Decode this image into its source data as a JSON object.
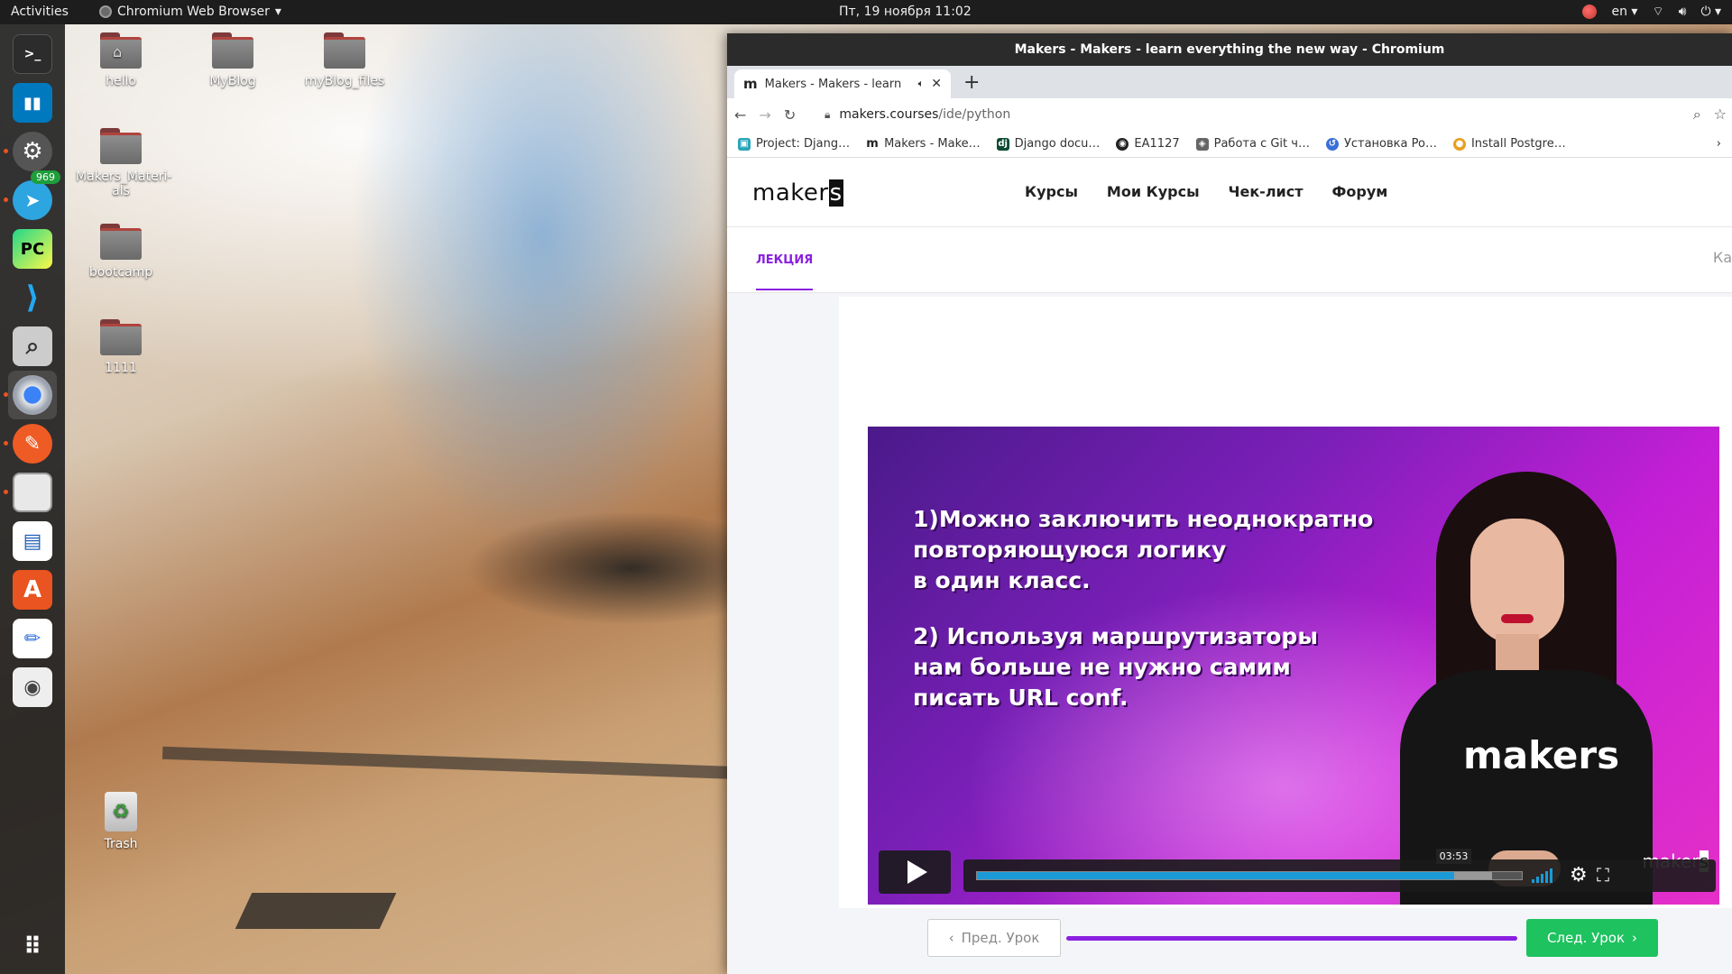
{
  "topbar": {
    "activities": "Activities",
    "app_name": "Chromium Web Browser",
    "clock": "Пт, 19 ноября  11:02",
    "lang": "en"
  },
  "dock": {
    "telegram_badge": "969",
    "items": [
      "terminal",
      "trello",
      "settings",
      "telegram",
      "pycharm",
      "vscode",
      "search",
      "chromium",
      "postman",
      "files",
      "writer",
      "software",
      "text-editor",
      "screenshot",
      "apps-grid"
    ]
  },
  "desktop": {
    "icons": [
      "hello",
      "MyBlog",
      "myBlog_files",
      "Makers_Materi-als",
      "bootcamp",
      "1111",
      "Trash"
    ]
  },
  "browser": {
    "window_title": "Makers - Makers - learn everything the new way - Chromium",
    "tab_title": "Makers - Makers - learn",
    "tab_favicon": "m",
    "url_domain": "makers.courses",
    "url_path": "/ide/python",
    "bookmarks": [
      "Project: Djang…",
      "Makers - Make…",
      "Django docu…",
      "EA1127",
      "Работа с Git ч…",
      "Установка Po…",
      "Install Postgre…"
    ]
  },
  "site": {
    "logo_text": "maker",
    "logo_last": "s",
    "nav": [
      "Курсы",
      "Мои Курсы",
      "Чек-лист",
      "Форум"
    ],
    "tab_lecture": "ЛЕКЦИЯ",
    "tab_cut": "Ка"
  },
  "video": {
    "lines": [
      "1)Можно заключить неоднократно",
      "повторяющуюся логику",
      "в один класс.",
      "2) Используя маршрутизаторы",
      "нам больше не нужно самим",
      "писать URL conf."
    ],
    "shirt_text": "makers",
    "watermark": "maker",
    "watermark_last": "s",
    "time_tooltip": "03:53",
    "progress_fraction": 0.875,
    "buffer_fraction": 0.945
  },
  "lesson_nav": {
    "prev_label": "Пред. Урок",
    "next_label": "След. Урок"
  },
  "colors": {
    "accent_purple": "#8a1fe0",
    "next_green": "#1ec25f",
    "progress_blue": "#1a9bd8"
  }
}
